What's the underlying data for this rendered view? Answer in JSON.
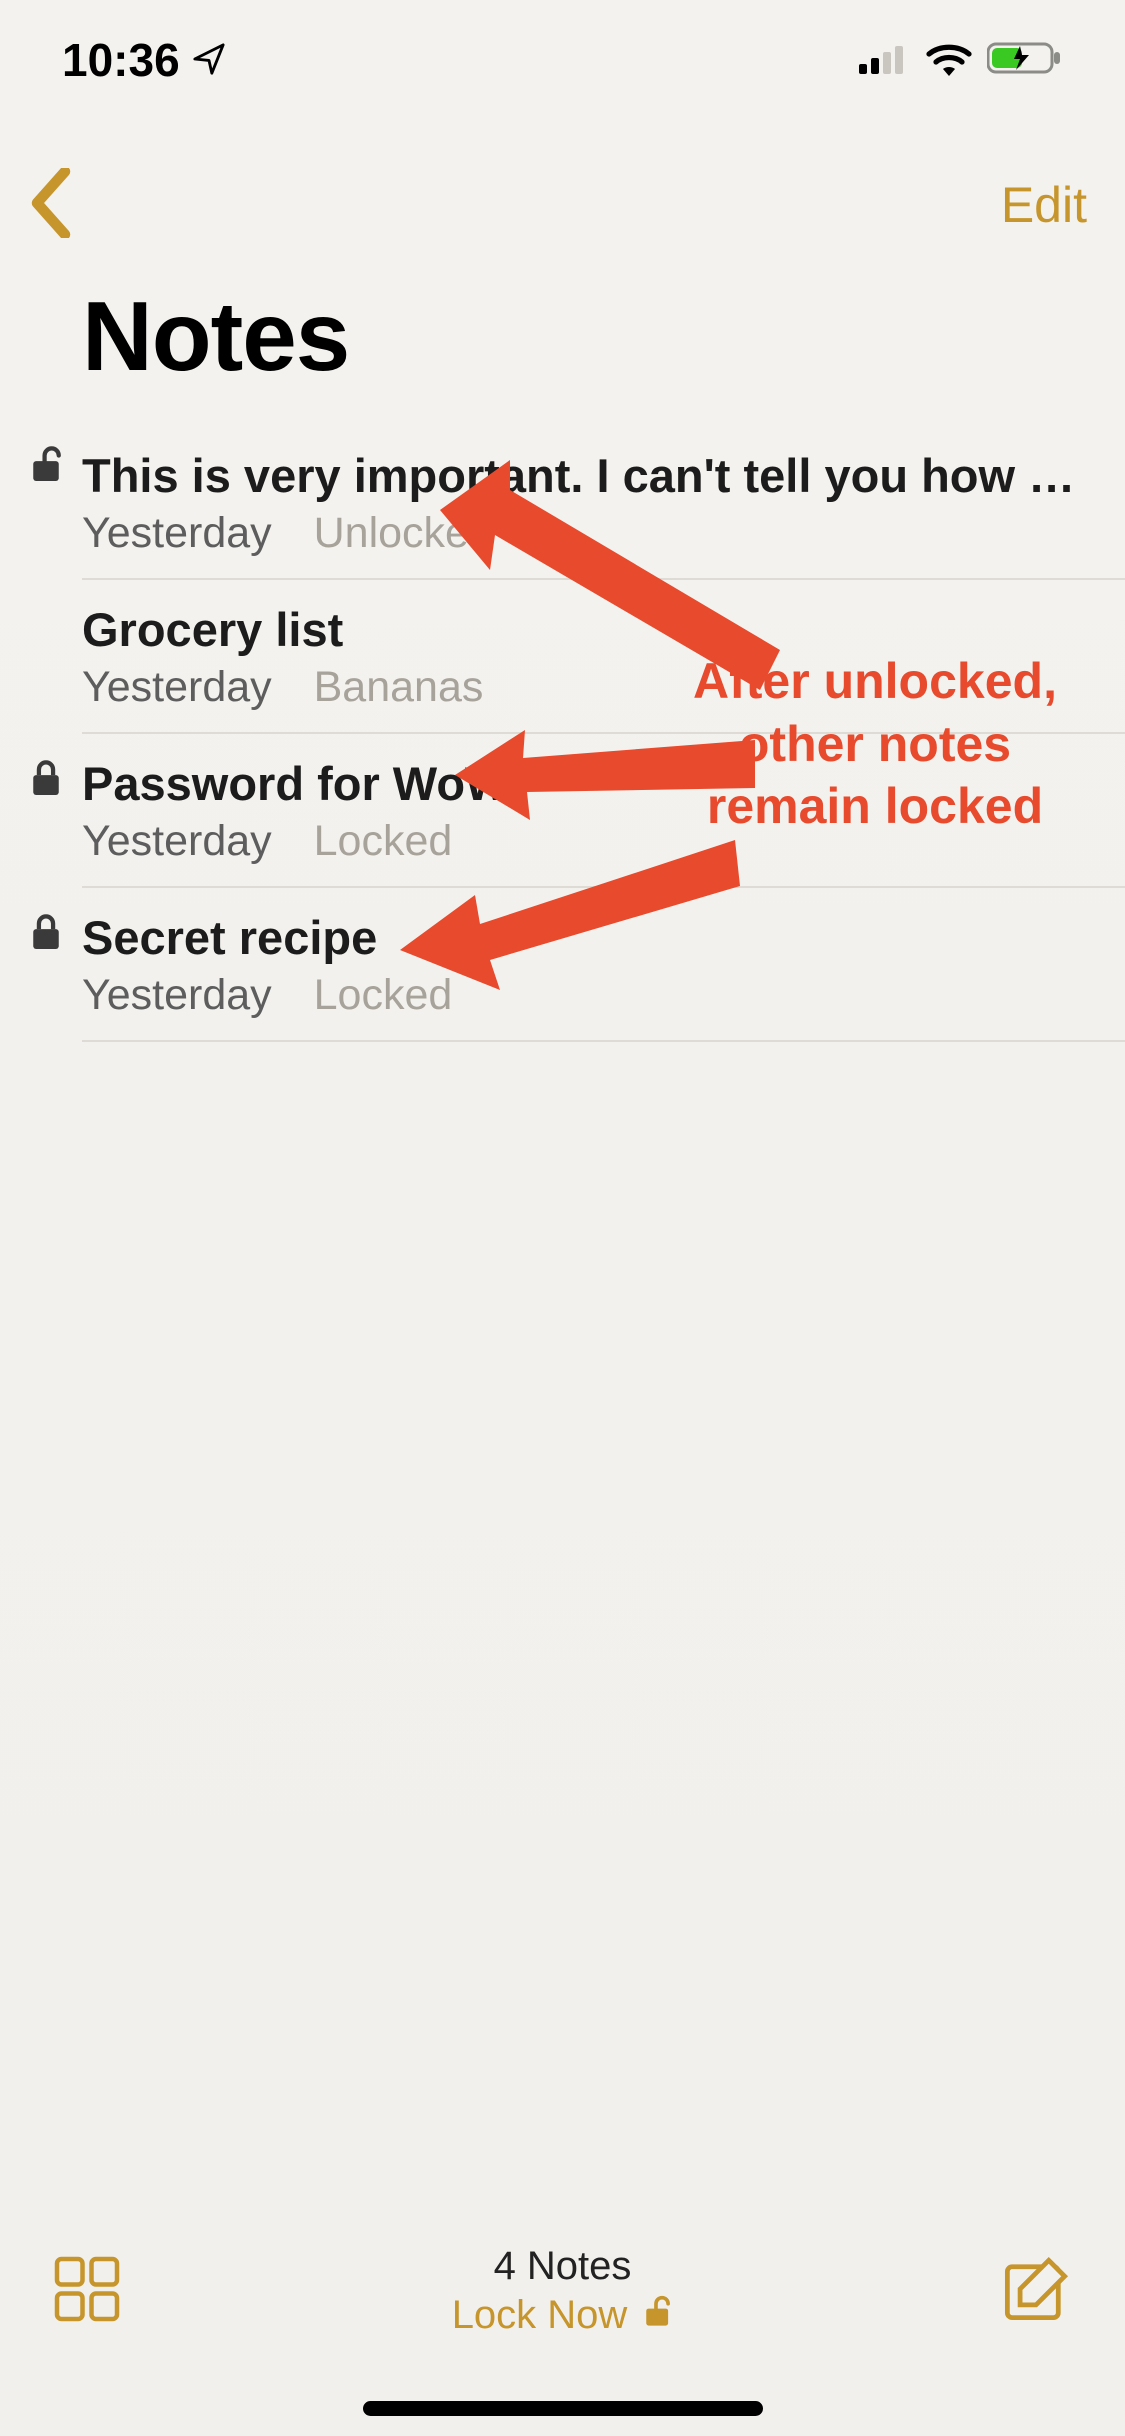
{
  "status": {
    "time": "10:36",
    "cellular_bars_active": 2,
    "cellular_bars_total": 4,
    "wifi": true,
    "battery_charging": true
  },
  "nav": {
    "edit_label": "Edit"
  },
  "title": "Notes",
  "notes": [
    {
      "title": "This is very important. I can't tell you how se…",
      "date": "Yesterday",
      "secondary": "Unlocked",
      "lock": "unlocked"
    },
    {
      "title": "Grocery list",
      "date": "Yesterday",
      "secondary": "Bananas",
      "lock": "none"
    },
    {
      "title": "Password for WoW",
      "date": "Yesterday",
      "secondary": "Locked",
      "lock": "locked"
    },
    {
      "title": "Secret recipe",
      "date": "Yesterday",
      "secondary": "Locked",
      "lock": "locked"
    }
  ],
  "toolbar": {
    "count_label": "4 Notes",
    "lock_now_label": "Lock Now"
  },
  "annotation": {
    "line1": "After unlocked,",
    "line2": "other notes",
    "line3": "remain locked"
  },
  "colors": {
    "accent": "#c6952b",
    "annotation": "#e74a2d"
  }
}
